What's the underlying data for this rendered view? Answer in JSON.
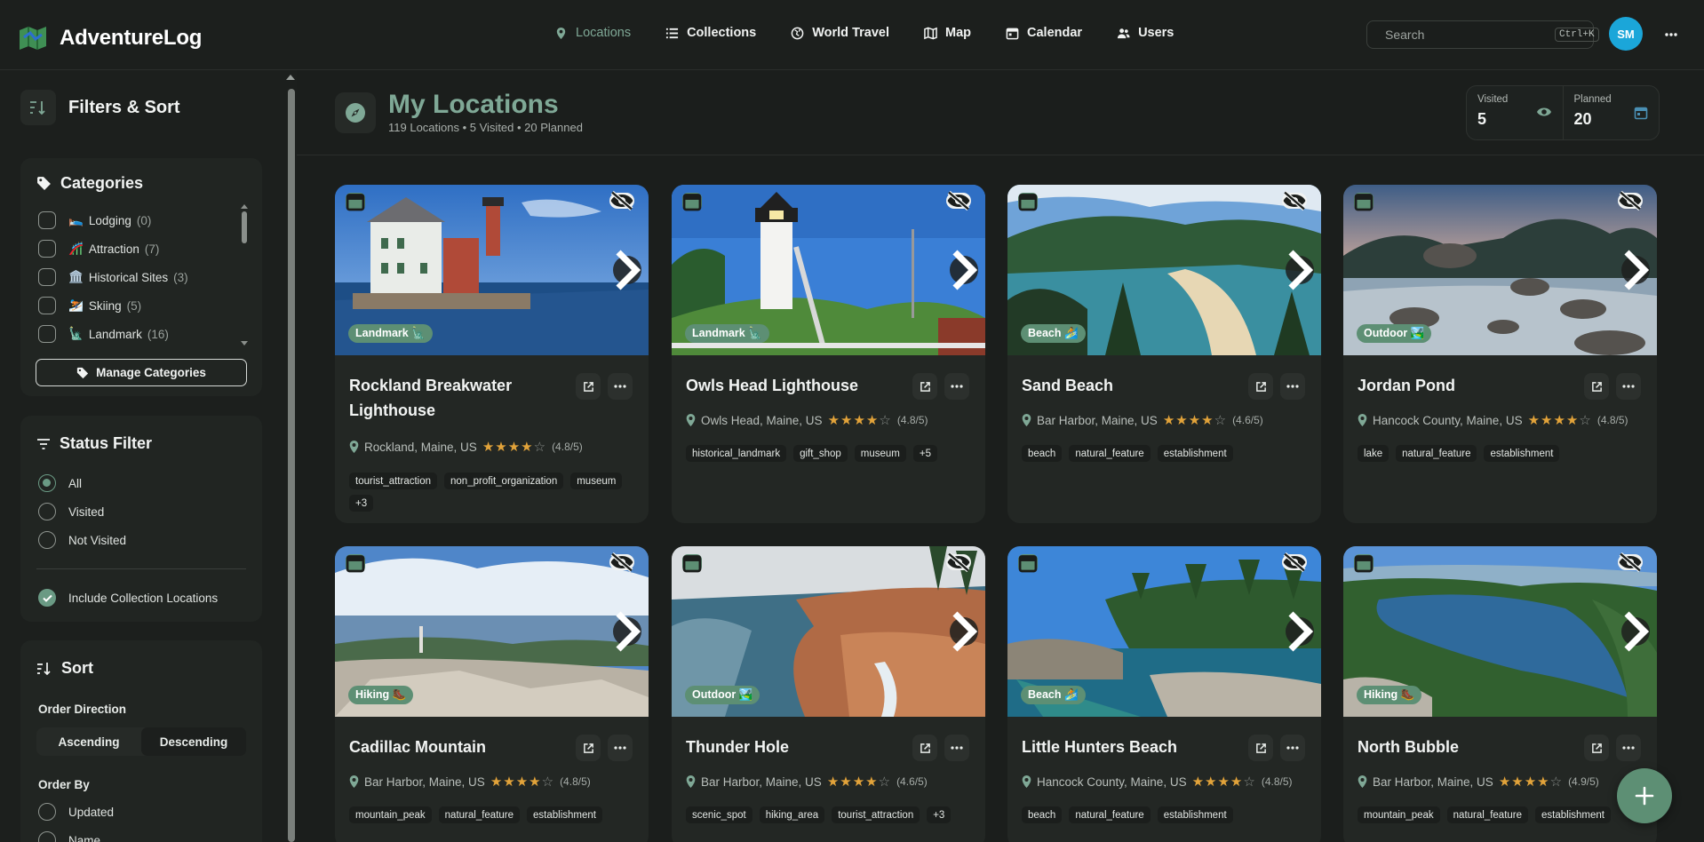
{
  "app": {
    "name": "AdventureLog"
  },
  "nav": {
    "items": [
      {
        "label": "Locations",
        "icon": "map-pin-icon",
        "active": true
      },
      {
        "label": "Collections",
        "icon": "list-icon"
      },
      {
        "label": "World Travel",
        "icon": "globe-icon"
      },
      {
        "label": "Map",
        "icon": "map-icon"
      },
      {
        "label": "Calendar",
        "icon": "calendar-icon"
      },
      {
        "label": "Users",
        "icon": "users-icon"
      }
    ],
    "search_placeholder": "Search",
    "search_shortcut": "Ctrl+K",
    "avatar_initials": "SM"
  },
  "sidebar": {
    "title": "Filters & Sort",
    "categories": {
      "title": "Categories",
      "items": [
        {
          "emoji": "🛌",
          "label": "Lodging",
          "count": "(0)"
        },
        {
          "emoji": "🎢",
          "label": "Attraction",
          "count": "(7)"
        },
        {
          "emoji": "🏛️",
          "label": "Historical Sites",
          "count": "(3)"
        },
        {
          "emoji": "⛷️",
          "label": "Skiing",
          "count": "(5)"
        },
        {
          "emoji": "🗽",
          "label": "Landmark",
          "count": "(16)"
        }
      ],
      "manage_label": "Manage Categories"
    },
    "status": {
      "title": "Status Filter",
      "options": [
        "All",
        "Visited",
        "Not Visited"
      ],
      "selected": "All",
      "include_collections_label": "Include Collection Locations",
      "include_collections_checked": true
    },
    "sort": {
      "title": "Sort",
      "direction_label": "Order Direction",
      "directions": [
        "Ascending",
        "Descending"
      ],
      "order_by_label": "Order By",
      "order_by_options": [
        "Updated",
        "Name"
      ]
    }
  },
  "main": {
    "title": "My Locations",
    "subtitle": "119 Locations • 5 Visited • 20 Planned",
    "stats": [
      {
        "label": "Visited",
        "value": "5",
        "icon": "eye-icon"
      },
      {
        "label": "Planned",
        "value": "20",
        "icon": "calendar-icon"
      }
    ]
  },
  "cards": [
    {
      "title": "Rockland Breakwater Lighthouse",
      "category": "Landmark 🗽",
      "location": "Rockland, Maine, US",
      "stars": 4,
      "rating": "(4.8/5)",
      "tags": [
        "tourist_attraction",
        "non_profit_organization",
        "museum",
        "+3"
      ]
    },
    {
      "title": "Owls Head Lighthouse",
      "category": "Landmark 🗽",
      "location": "Owls Head, Maine, US",
      "stars": 4,
      "rating": "(4.8/5)",
      "tags": [
        "historical_landmark",
        "gift_shop",
        "museum",
        "+5"
      ]
    },
    {
      "title": "Sand Beach",
      "category": "Beach 🏄",
      "location": "Bar Harbor, Maine, US",
      "stars": 4,
      "rating": "(4.6/5)",
      "tags": [
        "beach",
        "natural_feature",
        "establishment"
      ]
    },
    {
      "title": "Jordan Pond",
      "category": "Outdoor 🏞️",
      "location": "Hancock County, Maine, US",
      "stars": 4,
      "rating": "(4.8/5)",
      "tags": [
        "lake",
        "natural_feature",
        "establishment"
      ]
    },
    {
      "title": "Cadillac Mountain",
      "category": "Hiking 🥾",
      "location": "Bar Harbor, Maine, US",
      "stars": 4,
      "rating": "(4.8/5)",
      "tags": [
        "mountain_peak",
        "natural_feature",
        "establishment"
      ]
    },
    {
      "title": "Thunder Hole",
      "category": "Outdoor 🏞️",
      "location": "Bar Harbor, Maine, US",
      "stars": 4,
      "rating": "(4.6/5)",
      "tags": [
        "scenic_spot",
        "hiking_area",
        "tourist_attraction",
        "+3"
      ]
    },
    {
      "title": "Little Hunters Beach",
      "category": "Beach 🏄",
      "location": "Hancock County, Maine, US",
      "stars": 4,
      "rating": "(4.8/5)",
      "tags": [
        "beach",
        "natural_feature",
        "establishment"
      ]
    },
    {
      "title": "North Bubble",
      "category": "Hiking 🥾",
      "location": "Bar Harbor, Maine, US",
      "stars": 4,
      "rating": "(4.9/5)",
      "tags": [
        "mountain_peak",
        "natural_feature",
        "establishment"
      ]
    }
  ],
  "colors": {
    "accent": "#7fa896",
    "badge": "#5d8f74",
    "avatar": "#1ba6d9",
    "star": "#e2a33a"
  }
}
